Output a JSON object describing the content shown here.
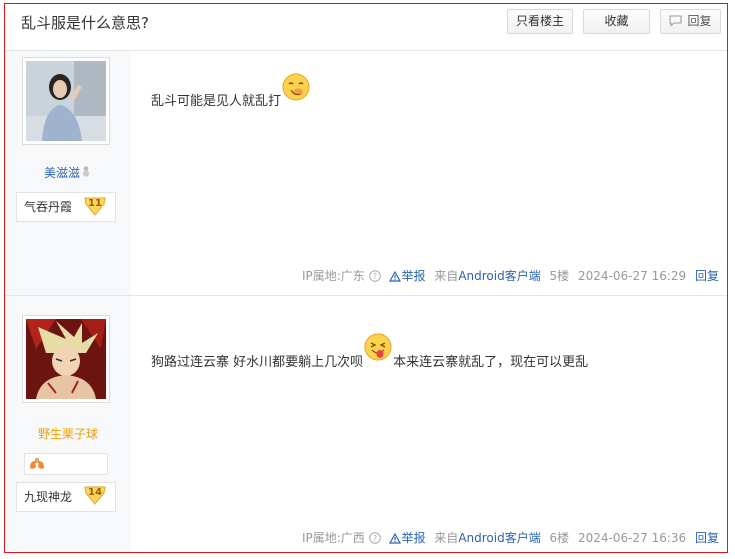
{
  "thread": {
    "title": "乱斗服是什么意思?",
    "buttons": {
      "only_op": "只看楼主",
      "favorite": "收藏",
      "reply": "回复"
    }
  },
  "posts": [
    {
      "user": {
        "name": "美滋滋",
        "badge_name": "气吞丹霞",
        "level": "11"
      },
      "content_text": "乱斗可能是见人就乱打",
      "content_after": "",
      "ip": "IP属地:广东",
      "report": "举报",
      "from": "来自",
      "client": "Android客户端",
      "floor": "5楼",
      "time": "2024-06-27 16:29",
      "reply": "回复"
    },
    {
      "user": {
        "name": "野生栗子球",
        "badge_name": "九现神龙",
        "level": "14"
      },
      "content_text": "狗路过连云寨 好水川都要躺上几次呗",
      "content_after": "本来连云寨就乱了，现在可以更乱",
      "ip": "IP属地:广西",
      "report": "举报",
      "from": "来自",
      "client": "Android客户端",
      "floor": "6楼",
      "time": "2024-06-27 16:36",
      "reply": "回复"
    }
  ],
  "colors": {
    "frame": "#e0161c",
    "link": "#2d64b3",
    "orange_name": "#f2a100",
    "meta": "#999999"
  }
}
